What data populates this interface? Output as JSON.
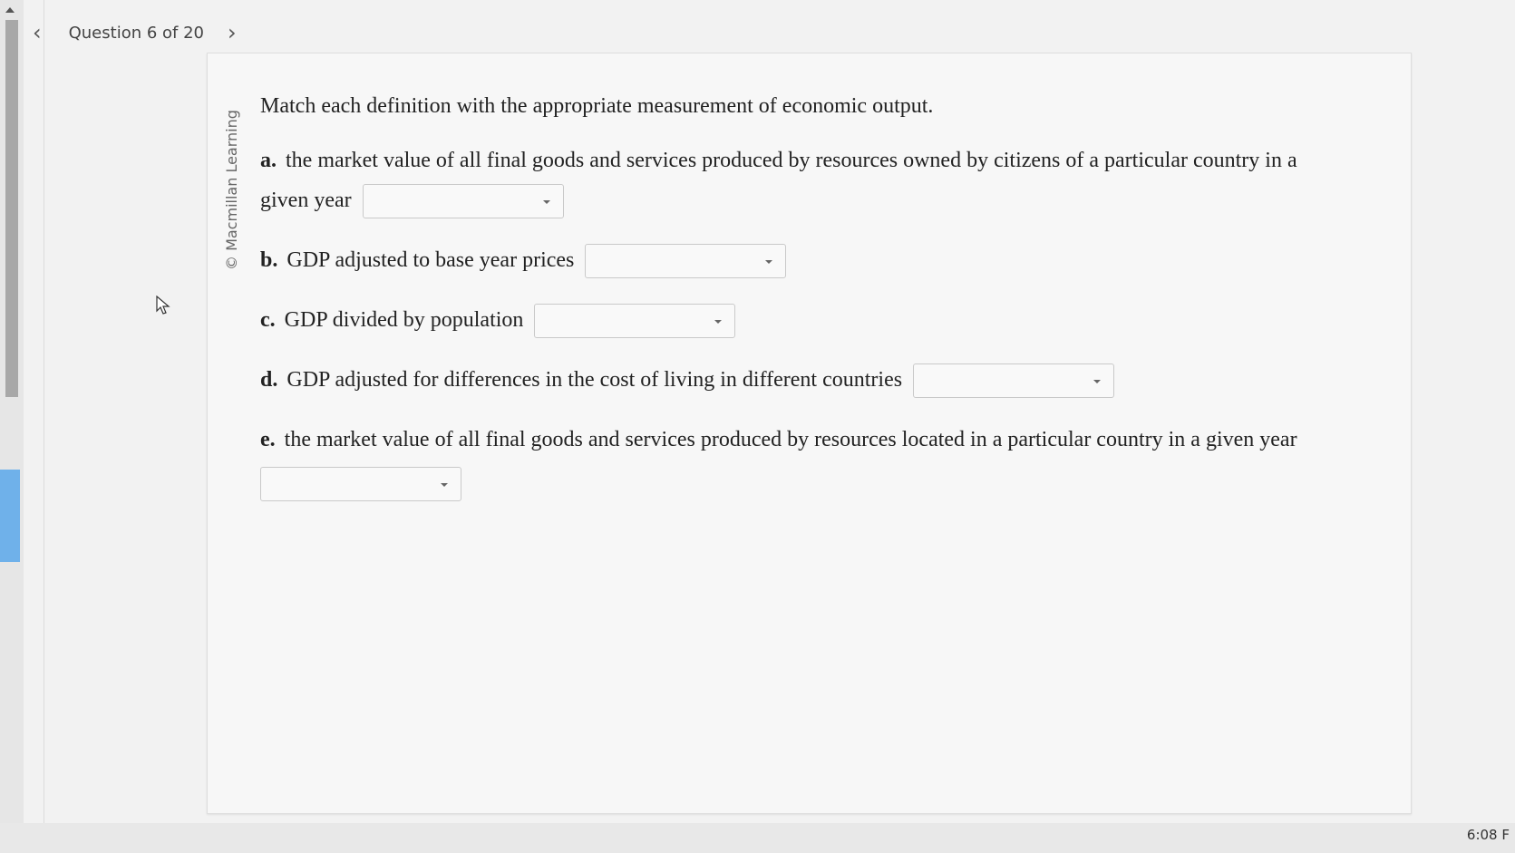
{
  "header": {
    "title": "Question 6 of 20",
    "prev_icon": "chevron-left-icon",
    "next_icon": "chevron-right-icon"
  },
  "copyright": "© Macmillan Learning",
  "question": {
    "prompt": "Match each definition with the appropriate measurement of economic output.",
    "items": [
      {
        "letter": "a.",
        "text": "the market value of all final goods and services produced by resources owned by citizens of a particular country in a given year",
        "selected": ""
      },
      {
        "letter": "b.",
        "text": "GDP adjusted to base year prices",
        "selected": ""
      },
      {
        "letter": "c.",
        "text": "GDP divided by population",
        "selected": ""
      },
      {
        "letter": "d.",
        "text": "GDP adjusted for differences in the cost of living in different countries",
        "selected": ""
      },
      {
        "letter": "e.",
        "text": "the market value of all final goods and services produced by resources located in a particular country in a given year",
        "selected": ""
      }
    ]
  },
  "taskbar": {
    "clock": "6:08 F"
  }
}
